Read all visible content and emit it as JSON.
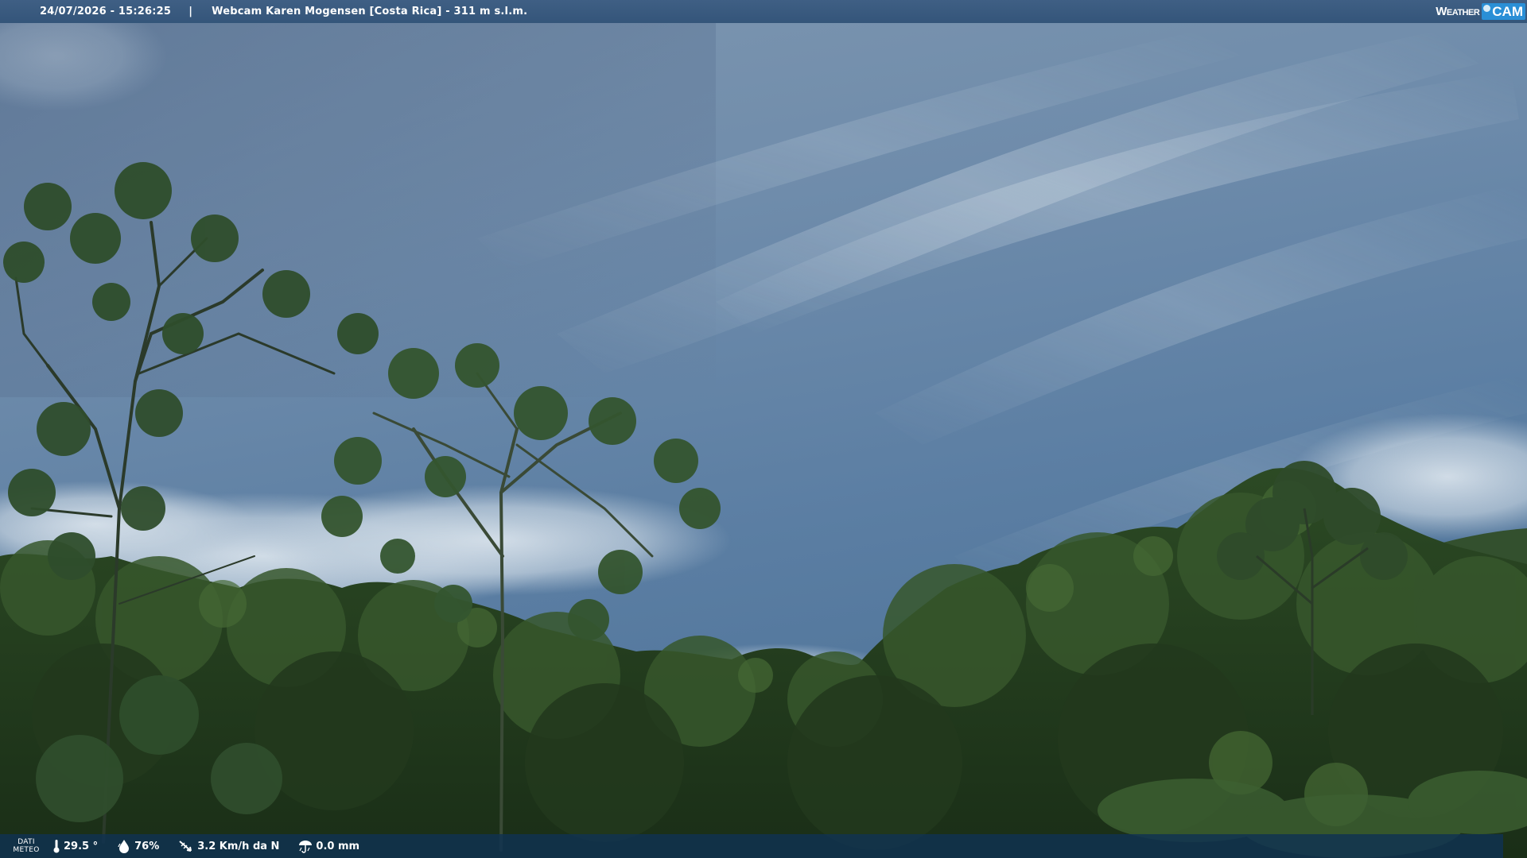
{
  "header": {
    "datetime": "24/07/2026 - 15:26:25",
    "separator": "|",
    "title": "Webcam Karen Mogensen [Costa Rica]  - 311 m s.l.m."
  },
  "brand": {
    "weather": "Weather",
    "cam": "CAM",
    "icon": "sun-dot-icon"
  },
  "meteo": {
    "label_line1": "DATI",
    "label_line2": "METEO",
    "temperature": "29.5 °",
    "humidity": "76%",
    "wind": "3.2 Km/h da N",
    "rain": "0.0 mm",
    "icons": [
      "thermometer-icon",
      "humidity-drop-icon",
      "wind-icon",
      "rain-icon"
    ]
  },
  "colors": {
    "bar_top": "#3a5a80",
    "bar_bottom": "#103252",
    "brand_accent": "#2a8fd6"
  }
}
